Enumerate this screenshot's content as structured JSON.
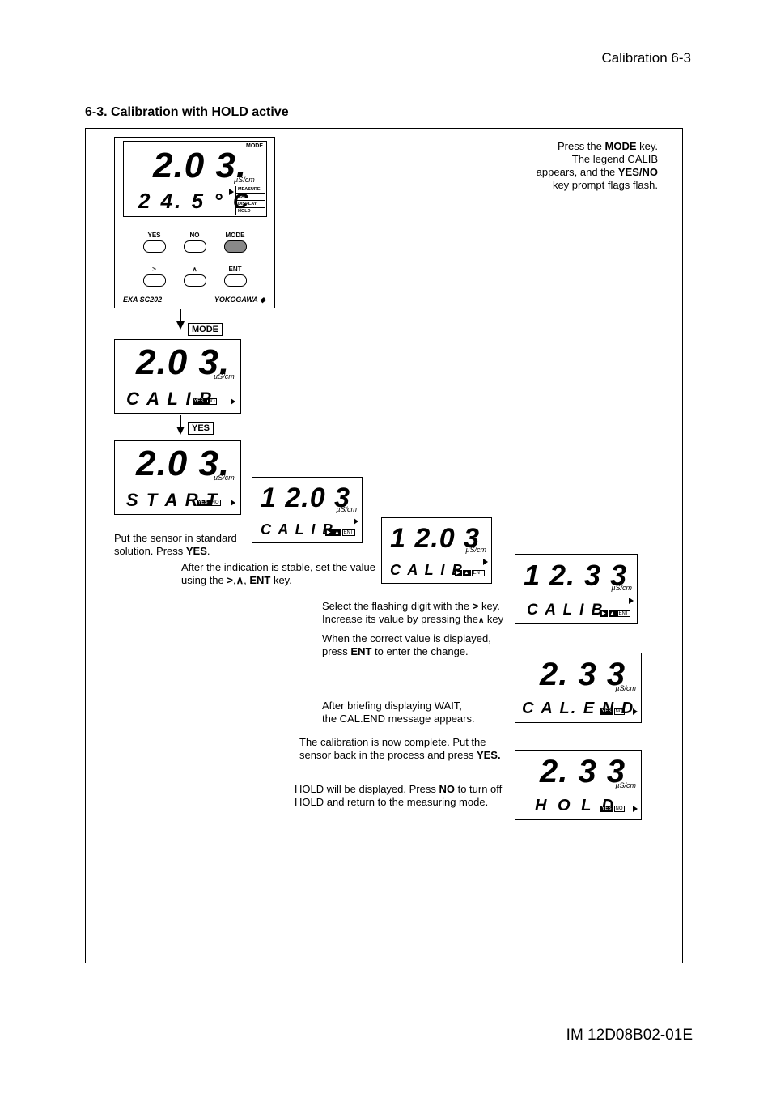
{
  "header": "Calibration 6-3",
  "section_title": "6-3. Calibration with HOLD active",
  "footer": "IM 12D08B02-01E",
  "labels": {
    "mode": "MODE",
    "yes": "YES",
    "no": "NO",
    "ent": "ENT",
    "hold": "HOLD",
    "right": ">",
    "up": "∧",
    "unit": "µS/cm",
    "brand": "YOKOGAWA",
    "logo": "EXA SC202",
    "measure": "MEASURE",
    "cal": "CAL",
    "display": "DISPLAY",
    "hold_s": "HOLD"
  },
  "screens": {
    "s1": {
      "main": "2.0 3.",
      "sub": "2 4. 5 ° C"
    },
    "s2": {
      "main": "2.0 3.",
      "sub": "C A L I B"
    },
    "s3": {
      "main": "2.0 3.",
      "sub": "S T A R T"
    },
    "s4": {
      "main": "1 2.0 3",
      "sub": "C A L I B"
    },
    "s5": {
      "main": "1 2.0 3",
      "sub": "C A L I B"
    },
    "s6": {
      "main": "1 2. 3 3",
      "sub": "C A L I B"
    },
    "s7": {
      "main": "2. 3 3",
      "sub": "C A L. E N D"
    },
    "s8": {
      "main": "2. 3 3",
      "sub": "H O L D"
    }
  },
  "text": {
    "t1a": "Press the ",
    "t1b": "MODE",
    "t1c": " key.",
    "t2a": "The legend CALIB",
    "t2b": "appears, and the ",
    "t2c": "YES/NO",
    "t2d": "key prompt flags flash.",
    "t3a": "Put the sensor in standard",
    "t3b": "solution. Press ",
    "t3c": "YES",
    "t4a": "After the indication is stable, ",
    "t4b": "set the value",
    "t4c": "using the ",
    "t4d": ">",
    "t4e": "∧",
    "t4f": "ENT",
    "t4g": " key.",
    "t5a": "Select the flashing digit with the ",
    "t5b": ">",
    "t5c": " key.",
    "t5d": "Increase its value by pressing the",
    "t5e": "∧",
    "t5f": "key",
    "t6a": "When the correct value is displayed,",
    "t6b": "press ",
    "t6c": "ENT",
    "t6d": " to  enter the change.",
    "t7a": "After briefing displaying WAIT,",
    "t7b": "the CAL.END message appears.",
    "t8a": "The calibration is now complete. Put the",
    "t8b": "sensor back in the process and press ",
    "t8c": "YES.",
    "t9a": "HOLD will be displayed. Press ",
    "t9b": "NO",
    "t9c": " to turn off",
    "t9d": "HOLD and return to the measuring mode."
  }
}
